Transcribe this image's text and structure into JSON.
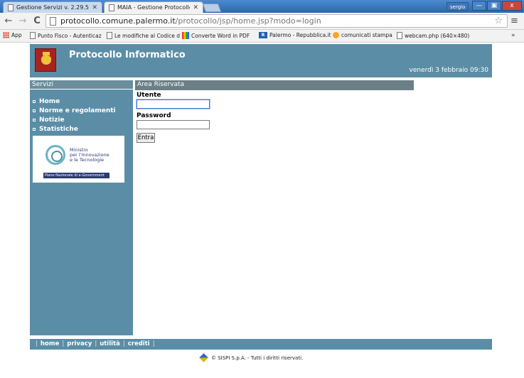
{
  "browser": {
    "tabs": [
      {
        "label": "Gestione Servizi v. 2.29.51 (",
        "active": false
      },
      {
        "label": "MAIA - Gestione Protocollo I",
        "active": true
      }
    ],
    "user": "sergio",
    "window_controls": {
      "minimize": "—",
      "maximize": "▣",
      "close": "x"
    },
    "nav": {
      "back": "←",
      "forward": "→",
      "reload": "C"
    },
    "url_host": "protocollo.comune.palermo.it",
    "url_path": "/protocollo/jsp/home.jsp?modo=login",
    "star": "☆",
    "menu": "≡",
    "bookmarks": [
      {
        "label": "App",
        "icon": "apps-icon"
      },
      {
        "label": "Punto Fisco - Autenticaz",
        "icon": "page-icon"
      },
      {
        "label": "Le modifiche al Codice d",
        "icon": "page-icon"
      },
      {
        "label": "Converte Word in PDF",
        "icon": "word-icon"
      },
      {
        "label": "Palermo - Repubblica.it",
        "icon": "repubblica-icon"
      },
      {
        "label": "comunicati stampa",
        "icon": "circle-icon"
      },
      {
        "label": "webcam.php (640×480)",
        "icon": "page-icon"
      }
    ],
    "bookmarks_more": "»"
  },
  "header": {
    "title": "Protocollo Informatico",
    "date": "venerdì 3 febbraio 09:30"
  },
  "sidebar": {
    "heading": "Servizi",
    "items": [
      "Home",
      "Norme e regolamenti",
      "Notizie",
      "Statistiche"
    ],
    "banner": {
      "text": "Ministro\nper l'Innovazione\ne le Tecnologie",
      "bar": "Piano Nazionale di e-Government"
    }
  },
  "main": {
    "heading": "Area Riservata",
    "user_label": "Utente",
    "password_label": "Password",
    "user_value": "",
    "password_value": "",
    "submit_label": "Entra"
  },
  "footer": {
    "links": [
      "home",
      "privacy",
      "utilità",
      "crediti"
    ],
    "copyright": "© SISPI S.p.A. - Tutti i diritti riservati."
  }
}
